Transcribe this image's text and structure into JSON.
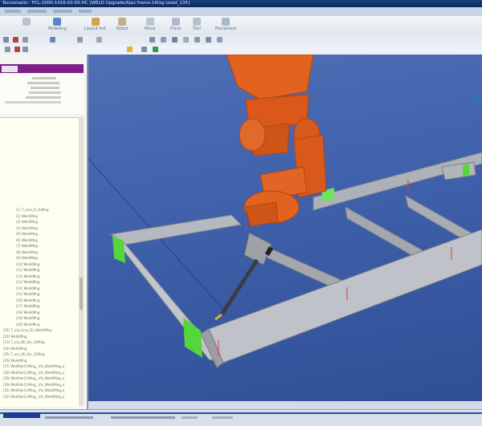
{
  "window": {
    "title": "Tecnomatix - FCL-1000-1016-02-05-HC [WELD Upgrade/Ajax frame-1Ktsg Lewd_135]"
  },
  "colors": {
    "title_bar": "#0c2a62",
    "viewport_bg": "#3f60aa",
    "robot": "#e2621f",
    "frame": "#b9bcc2",
    "weld_marker": "#55d63a",
    "tree_bg": "#fffff0",
    "panel_header": "#7d1f86"
  },
  "ribbon": {
    "buttons": [
      {
        "icon": "modeling-icon",
        "label": "Modeling"
      },
      {
        "icon": "layout-icon",
        "label": "Layout Ind."
      },
      {
        "icon": "robot-icon",
        "label": "Robot"
      },
      {
        "icon": "move-icon",
        "label": "Move"
      },
      {
        "icon": "place-icon",
        "label": "Place"
      },
      {
        "icon": "tool-icon",
        "label": "Tool"
      },
      {
        "icon": "placement-icon",
        "label": "Placement"
      }
    ]
  },
  "tree": {
    "lines": [
      "(1)  7_Line_6_(3)Mng",
      "(2)  Weld(Mng",
      "(3)  Weld(Mng",
      "(4)  Weld(Mng",
      "(5)  Weld(Mng",
      "(6)  Weld(Mng",
      "(7)  Weld(Mng",
      "(8)  Weld(Mng",
      "(9)  Weld(Mng",
      "(10) Weld(Mng",
      "(11) Weld(Mng",
      "(12) Weld(Mng",
      "(13) Weld(Mng",
      "(14) Weld(Mng",
      "(15) Weld(Mng",
      "(16) Weld(Mng",
      "(17) Weld(Mng",
      "(18) Weld(Mng",
      "(19) Weld(Mng",
      "(20) Weld(Mng",
      "(21) 7_via_Line_(3)_Weld(Mng",
      "(22) Weld(Mng",
      "(23) 7_via_(8)_Vis_(3)Mng",
      "(24) Weld(Mng",
      "(25) 7_via_(8)_Vis_(3)Mng",
      "(26) Weld(Mng",
      "(27) WeldVar(1)Mng__Vis_Weld(Mng_a",
      "(28) WeldVar(1)Mng__Vis_Weld(Mng_a",
      "(29) WeldVar(1)Mng__Vis_Weld(Mng_a",
      "(30) WeldVar(1)Mng__Vis_Weld(Mng_a",
      "(31) WeldVar(1)Mng__Vis_Weld(Mng_a",
      "(32) WeldVar(1)Mng__Vis_Weld(Mng_a"
    ]
  }
}
